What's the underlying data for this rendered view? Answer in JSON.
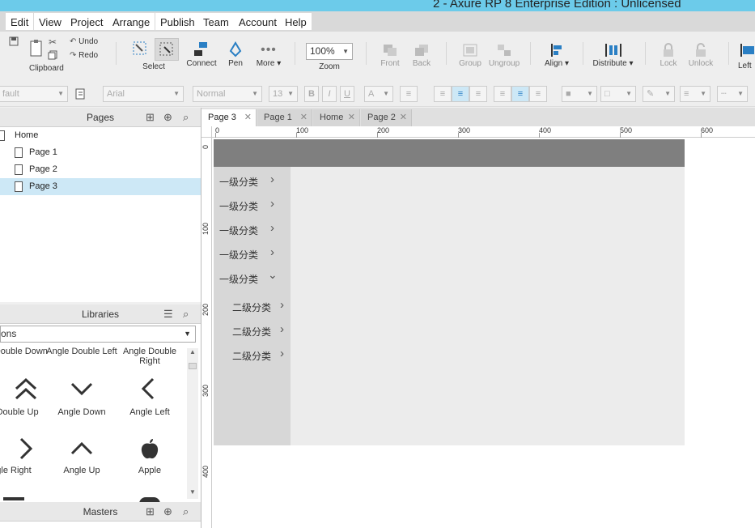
{
  "window": {
    "title": "2 - Axure RP 8 Enterprise Edition : Unlicensed"
  },
  "menu": [
    "Edit",
    "View",
    "Project",
    "Arrange",
    "Publish",
    "Team",
    "Account",
    "Help"
  ],
  "toolbar": {
    "undo": "Undo",
    "redo": "Redo",
    "clipboard": "Clipboard",
    "select": "Select",
    "connect": "Connect",
    "pen": "Pen",
    "more": "More ▾",
    "zoom_value": "100%",
    "zoom_label": "Zoom",
    "front": "Front",
    "back": "Back",
    "group": "Group",
    "ungroup": "Ungroup",
    "align": "Align ▾",
    "distribute": "Distribute ▾",
    "lock": "Lock",
    "unlock": "Unlock",
    "left": "Left"
  },
  "format": {
    "style": "fault",
    "font": "Arial",
    "weight": "Normal",
    "size": "13",
    "bold": "B",
    "italic": "I",
    "underline": "U",
    "fontcolor": "A"
  },
  "pages_panel": {
    "title": "Pages",
    "items": [
      {
        "label": "Home"
      },
      {
        "label": "Page 1"
      },
      {
        "label": "Page 2"
      },
      {
        "label": "Page 3"
      }
    ]
  },
  "libraries_panel": {
    "title": "Libraries",
    "selected": "ons",
    "items": [
      {
        "label": "gle Double Down"
      },
      {
        "label": "Angle Double Left"
      },
      {
        "label": "Angle Double Right"
      },
      {
        "label": "e Double Up"
      },
      {
        "label": "Angle Down"
      },
      {
        "label": "Angle Left"
      },
      {
        "label": "gle Right"
      },
      {
        "label": "Angle Up"
      },
      {
        "label": "Apple"
      }
    ]
  },
  "masters_panel": {
    "title": "Masters"
  },
  "tabs": [
    {
      "label": "Page 3"
    },
    {
      "label": "Page 1"
    },
    {
      "label": "Home"
    },
    {
      "label": "Page 2"
    }
  ],
  "ruler": {
    "h": [
      "0",
      "100",
      "200",
      "300",
      "400",
      "500",
      "600"
    ],
    "v": [
      "0",
      "100",
      "200",
      "300",
      "400"
    ]
  },
  "wireframe": {
    "level1": [
      "一级分类",
      "一级分类",
      "一级分类",
      "一级分类",
      "一级分类"
    ],
    "level2": [
      "二级分类",
      "二级分类",
      "二级分类"
    ],
    "chev_right": "›",
    "chev_down": "⌄"
  }
}
